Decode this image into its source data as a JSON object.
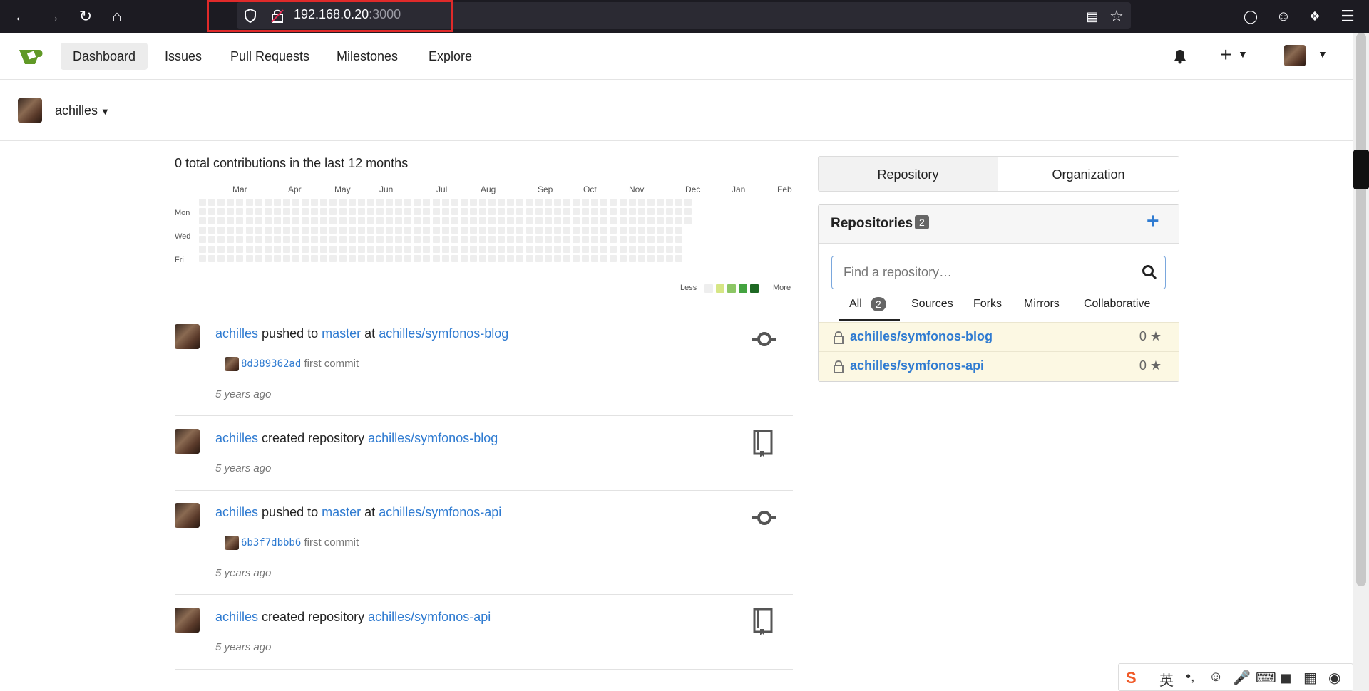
{
  "browser": {
    "url_host": "192.168.0.20",
    "url_port": ":3000"
  },
  "header": {
    "nav": [
      "Dashboard",
      "Issues",
      "Pull Requests",
      "Milestones",
      "Explore"
    ],
    "active_nav": "Dashboard"
  },
  "context": {
    "user": "achilles"
  },
  "heatmap": {
    "summary": "0 total contributions in the last 12 months",
    "months": [
      "Mar",
      "Apr",
      "May",
      "Jun",
      "Jul",
      "Aug",
      "Sep",
      "Oct",
      "Nov",
      "Dec",
      "Jan",
      "Feb"
    ],
    "days": [
      "Mon",
      "Wed",
      "Fri"
    ],
    "legend_less": "Less",
    "legend_more": "More",
    "legend_colors": [
      "#eeeeee",
      "#d6e685",
      "#8cc665",
      "#44a340",
      "#1e6823"
    ]
  },
  "feed": [
    {
      "user": "achilles",
      "action": "pushed to",
      "branch": "master",
      "at": "at",
      "repo": "achilles/symfonos-blog",
      "commit_sha": "8d389362ad",
      "commit_msg": "first commit",
      "time": "5 years ago",
      "icon": "commit-icon"
    },
    {
      "user": "achilles",
      "action": "created repository",
      "repo": "achilles/symfonos-blog",
      "time": "5 years ago",
      "icon": "repo-book-icon"
    },
    {
      "user": "achilles",
      "action": "pushed to",
      "branch": "master",
      "at": "at",
      "repo": "achilles/symfonos-api",
      "commit_sha": "6b3f7dbbb6",
      "commit_msg": "first commit",
      "time": "5 years ago",
      "icon": "commit-icon"
    },
    {
      "user": "achilles",
      "action": "created repository",
      "repo": "achilles/symfonos-api",
      "time": "5 years ago",
      "icon": "repo-book-icon"
    }
  ],
  "sidebar": {
    "tabs": [
      "Repository",
      "Organization"
    ],
    "repos_title": "Repositories",
    "repos_count": "2",
    "search_placeholder": "Find a repository…",
    "filters": [
      {
        "label": "All",
        "count": "2"
      },
      {
        "label": "Sources"
      },
      {
        "label": "Forks"
      },
      {
        "label": "Mirrors"
      },
      {
        "label": "Collaborative"
      }
    ],
    "repos": [
      {
        "name": "achilles/symfonos-blog",
        "stars": "0"
      },
      {
        "name": "achilles/symfonos-api",
        "stars": "0"
      }
    ]
  },
  "ime": {
    "lang": "英"
  },
  "colors": {
    "link": "#2f7bd1",
    "accent_plus": "#2f7bd1",
    "highlight": "#e02a2a"
  }
}
